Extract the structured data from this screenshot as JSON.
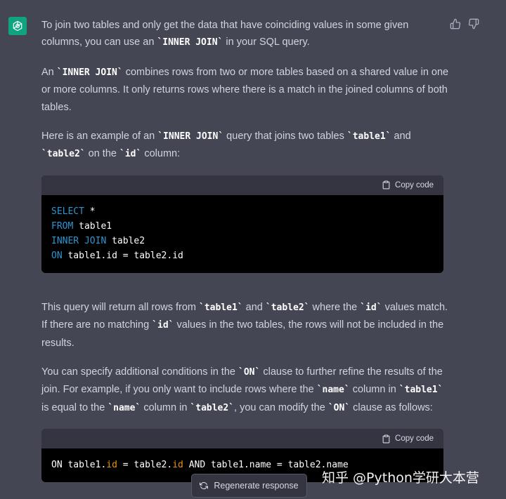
{
  "message": {
    "paragraphs": [
      [
        "To join two tables and only get the data that have coinciding values in some given columns, you can use an ",
        {
          "code": "`INNER JOIN`"
        },
        " in your SQL query."
      ],
      [
        "An ",
        {
          "code": "`INNER JOIN`"
        },
        " combines rows from two or more tables based on a shared value in one or more columns. It only returns rows where there is a match in the joined columns of both tables."
      ],
      [
        "Here is an example of an ",
        {
          "code": "`INNER JOIN`"
        },
        " query that joins two tables ",
        {
          "code": "`table1`"
        },
        " and ",
        {
          "code": "`table2`"
        },
        " on the ",
        {
          "code": "`id`"
        },
        " column:"
      ]
    ],
    "paragraphs_after": [
      [
        "This query will return all rows from ",
        {
          "code": "`table1`"
        },
        " and ",
        {
          "code": "`table2`"
        },
        " where the ",
        {
          "code": "`id`"
        },
        " values match. If there are no matching ",
        {
          "code": "`id`"
        },
        " values in the two tables, the rows will not be included in the results."
      ],
      [
        "You can specify additional conditions in the ",
        {
          "code": "`ON`"
        },
        " clause to further refine the results of the join. For example, if you only want to include rows where the ",
        {
          "code": "`name`"
        },
        " column in ",
        {
          "code": "`table1`"
        },
        " is equal to the ",
        {
          "code": "`name`"
        },
        " column in ",
        {
          "code": "`table2`"
        },
        ", you can modify the ",
        {
          "code": "`ON`"
        },
        " clause as follows:"
      ]
    ]
  },
  "code_blocks": [
    {
      "copy_label": "Copy code",
      "lines": [
        [
          {
            "t": "SELECT",
            "c": "kw"
          },
          {
            "t": " *"
          }
        ],
        [
          {
            "t": "FROM",
            "c": "kw"
          },
          {
            "t": " table1"
          }
        ],
        [
          {
            "t": "INNER JOIN",
            "c": "kw"
          },
          {
            "t": " table2"
          }
        ],
        [
          {
            "t": "ON",
            "c": "kw"
          },
          {
            "t": " table1.id = table2.id"
          }
        ]
      ]
    },
    {
      "copy_label": "Copy code",
      "lines": [
        [
          {
            "t": "ON table1."
          },
          {
            "t": "id",
            "c": "attr"
          },
          {
            "t": " = table2."
          },
          {
            "t": "id",
            "c": "attr"
          },
          {
            "t": " AND table1.name = table2.name"
          }
        ]
      ]
    }
  ],
  "regenerate_label": "Regenerate response",
  "watermark": "知乎 @Python学研大本营",
  "colors": {
    "background": "#444654",
    "avatar": "#10a37f",
    "code_bg": "#000000",
    "code_header": "#343541",
    "keyword": "#2e95d3",
    "attribute": "#e9950c"
  },
  "icons": {
    "avatar": "openai-logo-icon",
    "thumbs_up": "thumbs-up-icon",
    "thumbs_down": "thumbs-down-icon",
    "copy": "clipboard-icon",
    "regenerate": "refresh-icon"
  }
}
